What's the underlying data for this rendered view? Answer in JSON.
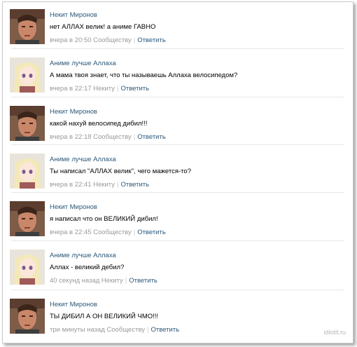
{
  "comments": [
    {
      "author": "Некит Миронов",
      "avatar": "man",
      "text": "нет АЛЛАХ велик! а аниме ГАВНО",
      "meta": "вчера в 20:50 Сообществу",
      "reply": "Ответить"
    },
    {
      "author": "Аниме лучше Аллаха",
      "avatar": "anime",
      "text": "А мама твоя знает, что ты называешь Аллаха велосипедом?",
      "meta": "вчера в 22:17 Некиту",
      "reply": "Ответить"
    },
    {
      "author": "Некит Миронов",
      "avatar": "man",
      "text": "какой нахуй велосипед дибил!!!",
      "meta": "вчера в 22:18 Сообществу",
      "reply": "Ответить"
    },
    {
      "author": "Аниме лучше Аллаха",
      "avatar": "anime",
      "text": "Ты написал \"АЛЛАХ велик\", чего мажется-то?",
      "meta": "вчера в 22:41 Некиту",
      "reply": "Ответить"
    },
    {
      "author": "Некит Миронов",
      "avatar": "man",
      "text": "я написал что он ВЕЛИКИЙ дибил!",
      "meta": "вчера в 22:45 Сообществу",
      "reply": "Ответить"
    },
    {
      "author": "Аниме лучше Аллаха",
      "avatar": "anime",
      "text": "Аллах - великий дебил?",
      "meta": "40 секунд назад Некиту",
      "reply": "Ответить"
    },
    {
      "author": "Некит Миронов",
      "avatar": "man",
      "text": "ТЫ ДИБИЛ А ОН ВЕЛИКИЙ ЧМО!!!",
      "meta": "три минуты назад Сообществу",
      "reply": "Ответить"
    }
  ],
  "watermark": "idiotit.ru",
  "colors": {
    "link": "#2b587a",
    "meta": "#999999",
    "divider": "#e4e6ea"
  }
}
